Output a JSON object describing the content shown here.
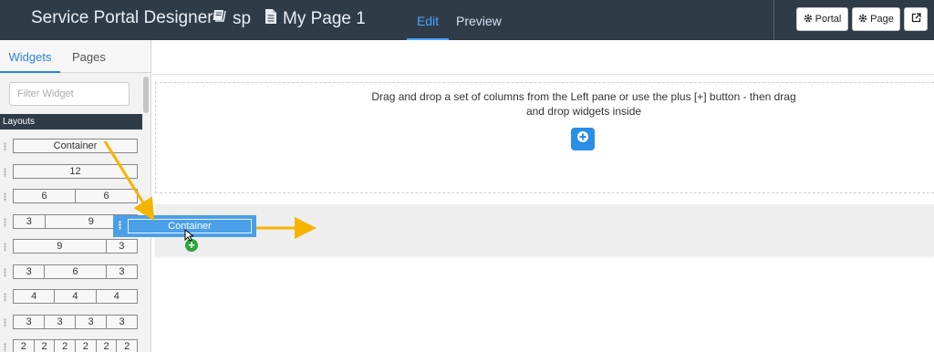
{
  "header": {
    "app_title": "Service Portal Designer",
    "site": "sp",
    "page": "My Page 1",
    "tabs": [
      "Edit",
      "Preview"
    ],
    "buttons": {
      "portal": "Portal",
      "page": "Page"
    }
  },
  "sidebar": {
    "tabs": [
      "Widgets",
      "Pages"
    ],
    "filter_placeholder": "Filter Widget",
    "section_title": "Layouts",
    "layouts": [
      [
        "Container"
      ],
      [
        "12"
      ],
      [
        "6",
        "6"
      ],
      [
        "3",
        "9"
      ],
      [
        "9",
        "3"
      ],
      [
        "3",
        "6",
        "3"
      ],
      [
        "4",
        "4",
        "4"
      ],
      [
        "3",
        "3",
        "3",
        "3"
      ],
      [
        "2",
        "2",
        "2",
        "2",
        "2",
        "2"
      ]
    ]
  },
  "canvas": {
    "instruction": "Drag and drop a set of columns from the Left pane or use the plus [+] button - then drag and drop widgets inside"
  },
  "drag": {
    "label": "Container",
    "drop_indicator": "+"
  },
  "colors": {
    "topbar": "#2f3c48",
    "accent": "#4aa3ff",
    "button_blue": "#2a8ee6",
    "arrow": "#f5b400",
    "drop_plus": "#2aa53d"
  },
  "icons": [
    "book-icon",
    "document-icon",
    "gear-icon",
    "external-link-icon",
    "plus-circle-icon",
    "grip-icon",
    "cursor-icon"
  ]
}
